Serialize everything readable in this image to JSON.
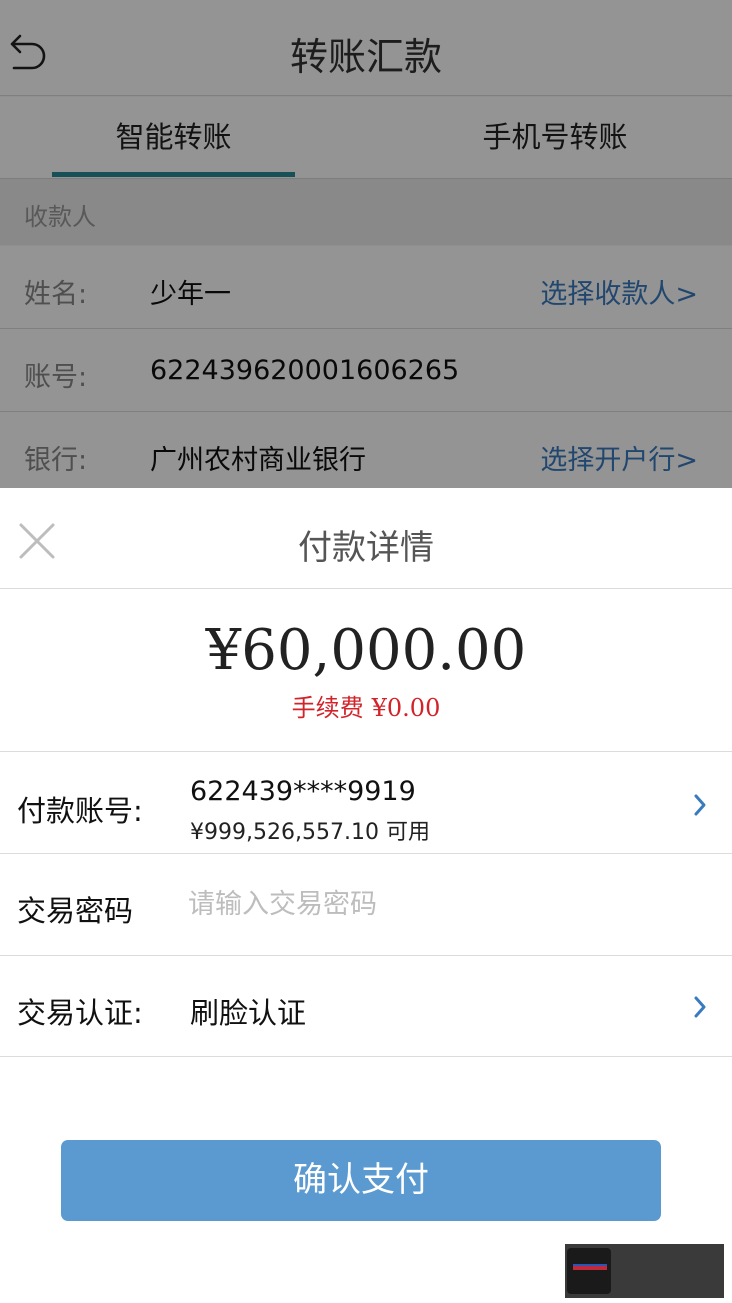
{
  "nav": {
    "title": "转账汇款"
  },
  "tabs": [
    {
      "label": "智能转账",
      "active": true
    },
    {
      "label": "手机号转账",
      "active": false
    }
  ],
  "payee_section": {
    "header": "收款人",
    "name_label": "姓名:",
    "name_value": "少年一",
    "choose_payee": "选择收款人>",
    "account_label": "账号:",
    "account_value": "622439620001606265",
    "bank_label": "银行:",
    "bank_value": "广州农村商业银行",
    "choose_bank": "选择开户行>"
  },
  "sheet": {
    "title": "付款详情",
    "amount": "¥60,000.00",
    "fee_label": "手续费",
    "fee_value": "¥0.00",
    "pay_account_label": "付款账号:",
    "pay_account_number": "622439****9919",
    "pay_account_balance": "¥999,526,557.10 可用",
    "password_label": "交易密码",
    "password_placeholder": "请输入交易密码",
    "password_value": "",
    "auth_label": "交易认证:",
    "auth_value": "刷脸认证",
    "confirm_button": "确认支付"
  },
  "colors": {
    "tab_underline": "#2a8a98",
    "link": "#3a7bbf",
    "fee": "#d2232a",
    "button": "#5a9ad0"
  },
  "icons": [
    "back-icon",
    "close-icon",
    "chevron-right-icon"
  ]
}
